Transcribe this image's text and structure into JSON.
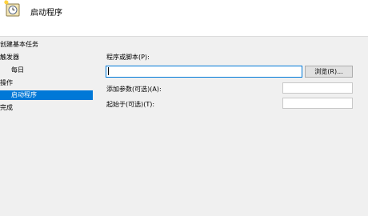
{
  "header": {
    "title": "启动程序"
  },
  "sidebar": {
    "items": [
      {
        "label": "创建基本任务"
      },
      {
        "label": "触发器"
      },
      {
        "label": "每日"
      },
      {
        "label": "操作"
      },
      {
        "label": "启动程序"
      },
      {
        "label": "完成"
      }
    ]
  },
  "form": {
    "program_label": "程序或脚本(P):",
    "program_value": "",
    "browse_label": "浏览(R)...",
    "args_label": "添加参数(可选)(A):",
    "args_value": "",
    "startin_label": "起始于(可选)(T):",
    "startin_value": ""
  },
  "colors": {
    "selected": "#0078d7",
    "background": "#f0f0f0"
  }
}
